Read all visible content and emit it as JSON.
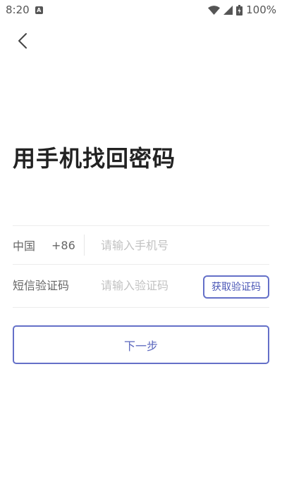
{
  "status_bar": {
    "time": "8:20",
    "notification_icon": "A",
    "battery_percent": "100%",
    "icons": [
      "wifi-icon",
      "signal-icon",
      "battery-charging-icon"
    ]
  },
  "header": {
    "back_icon": "chevron-left-icon"
  },
  "title": "用手机找回密码",
  "phone_row": {
    "country": "中国",
    "dial_code": "+86",
    "placeholder": "请输入手机号",
    "value": ""
  },
  "code_row": {
    "label": "短信验证码",
    "placeholder": "请输入验证码",
    "value": "",
    "get_code_label": "获取验证码"
  },
  "next_button_label": "下一步",
  "colors": {
    "accent": "#6470c8",
    "title": "#222222",
    "placeholder": "#c2c2c2"
  }
}
